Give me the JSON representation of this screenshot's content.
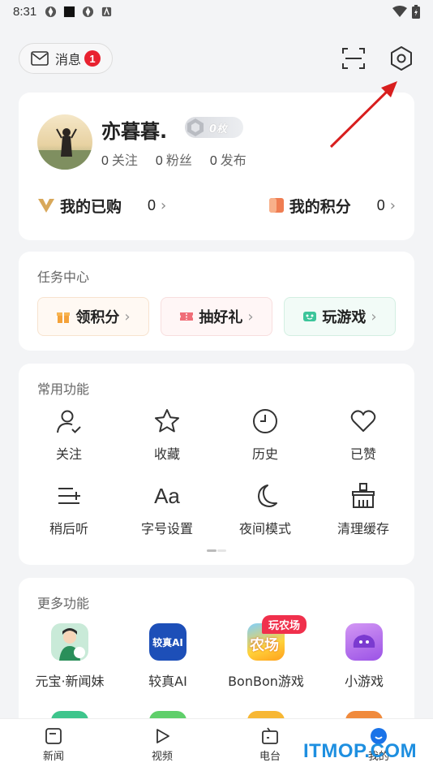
{
  "status_bar": {
    "time": "8:31"
  },
  "top_bar": {
    "messages_label": "消息",
    "messages_badge": "1"
  },
  "profile": {
    "username": "亦暮暮.",
    "level_text": "0枚",
    "stats": [
      {
        "num": "0",
        "label": "关注"
      },
      {
        "num": "0",
        "label": "粉丝"
      },
      {
        "num": "0",
        "label": "发布"
      }
    ],
    "purchased_label": "我的已购",
    "purchased_value": "0",
    "points_label": "我的积分",
    "points_value": "0"
  },
  "tasks": {
    "title": "任务中心",
    "buttons": [
      {
        "label": "领积分"
      },
      {
        "label": "抽好礼"
      },
      {
        "label": "玩游戏"
      }
    ]
  },
  "common": {
    "title": "常用功能",
    "items": [
      {
        "label": "关注",
        "icon": "user-check-icon"
      },
      {
        "label": "收藏",
        "icon": "star-icon"
      },
      {
        "label": "历史",
        "icon": "clock-icon"
      },
      {
        "label": "已赞",
        "icon": "heart-icon"
      },
      {
        "label": "稍后听",
        "icon": "playlist-add-icon"
      },
      {
        "label": "字号设置",
        "icon": "font-size-icon",
        "glyph": "Aa"
      },
      {
        "label": "夜间模式",
        "icon": "moon-icon"
      },
      {
        "label": "清理缓存",
        "icon": "broom-icon"
      }
    ]
  },
  "more": {
    "title": "更多功能",
    "items": [
      {
        "label": "元宝·新闻妹",
        "icon": "yuanbao-avatar-icon",
        "color": "#c9ead8"
      },
      {
        "label": "较真AI",
        "icon": "jiaozhen-ai-icon",
        "color": "#1d4fb8",
        "icon_text": "较真AI"
      },
      {
        "label": "BonBon游戏",
        "icon": "farm-game-icon",
        "color": "#ffd23a",
        "tag": "玩农场",
        "icon_text": "农场"
      },
      {
        "label": "小游戏",
        "icon": "mini-game-icon",
        "color": "#b36ae8"
      }
    ]
  },
  "tab_bar": {
    "tabs": [
      {
        "label": "新闻",
        "icon": "news-icon"
      },
      {
        "label": "视频",
        "icon": "video-icon"
      },
      {
        "label": "电台",
        "icon": "radio-icon"
      },
      {
        "label": "我的",
        "icon": "profile-icon"
      }
    ]
  },
  "watermark": "ITMOP.COM",
  "colors": {
    "accent_red": "#e8212f",
    "annotation_arrow": "#d81e1e"
  }
}
